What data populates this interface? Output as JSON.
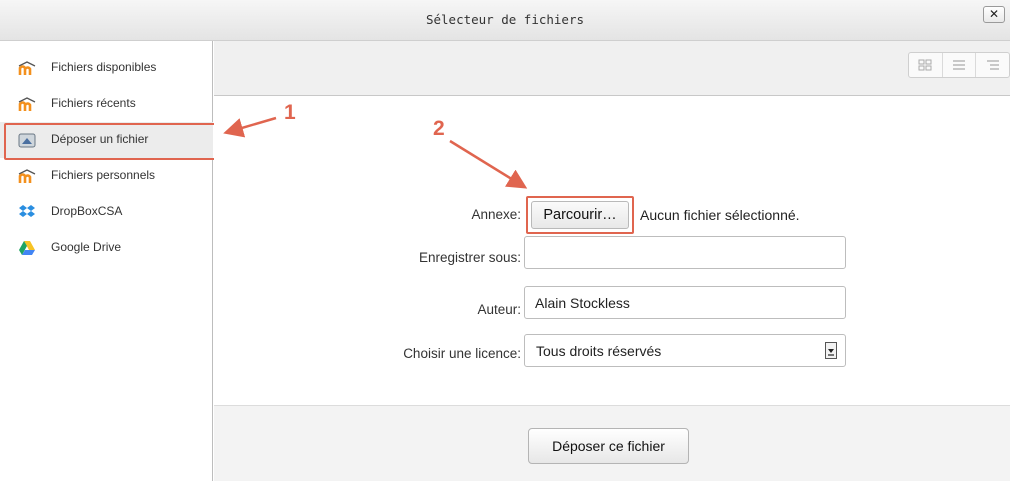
{
  "dialog": {
    "title": "Sélecteur de fichiers",
    "close_label": "✕"
  },
  "sidebar": {
    "items": [
      {
        "label": "Fichiers disponibles",
        "icon": "moodle-icon"
      },
      {
        "label": "Fichiers récents",
        "icon": "moodle-icon"
      },
      {
        "label": "Déposer un fichier",
        "icon": "upload-icon",
        "selected": true
      },
      {
        "label": "Fichiers personnels",
        "icon": "moodle-icon"
      },
      {
        "label": "DropBoxCSA",
        "icon": "dropbox-icon"
      },
      {
        "label": "Google Drive",
        "icon": "google-drive-icon"
      }
    ]
  },
  "toolbar": {
    "views": [
      "grid-view-icon",
      "list-view-icon",
      "tree-view-icon"
    ]
  },
  "form": {
    "attachment_label": "Annexe:",
    "browse_label": "Parcourir…",
    "no_file_text": "Aucun fichier sélectionné.",
    "save_as_label": "Enregistrer sous:",
    "save_as_value": "",
    "author_label": "Auteur:",
    "author_value": "Alain Stockless",
    "license_label": "Choisir une licence:",
    "license_value": "Tous droits réservés"
  },
  "footer": {
    "upload_label": "Déposer ce fichier"
  },
  "annotations": {
    "step1": "1",
    "step2": "2"
  },
  "colors": {
    "annotation": "#e0654f",
    "moodle_orange": "#f3901d",
    "dropbox_blue": "#2a8ee0"
  }
}
